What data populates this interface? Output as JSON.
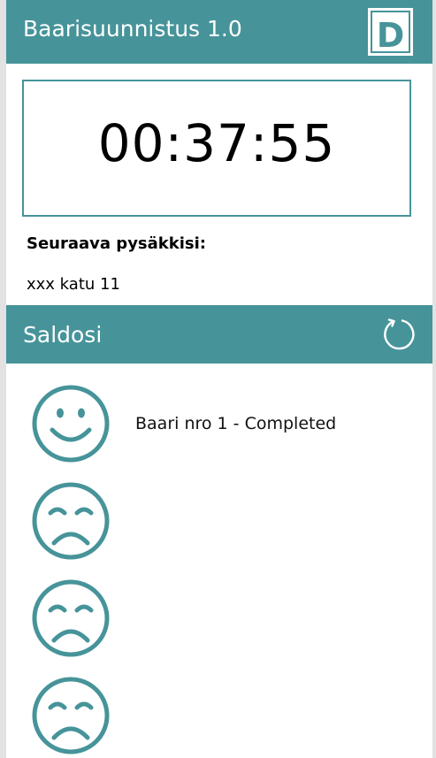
{
  "header": {
    "title": "Baarisuunnistus 1.0",
    "logo_letter": "D"
  },
  "timer": {
    "value": "00:37:55"
  },
  "next_stop": {
    "label": "Seuraava pysäkkisi:",
    "address": "xxx katu 11"
  },
  "balance": {
    "title": "Saldosi",
    "refresh_icon": "refresh-icon"
  },
  "bars": [
    {
      "status": "happy",
      "label": "Baari nro 1 - Completed"
    },
    {
      "status": "sad",
      "label": ""
    },
    {
      "status": "sad",
      "label": ""
    },
    {
      "status": "sad",
      "label": ""
    }
  ],
  "colors": {
    "accent": "#46949a",
    "header_text": "#ffffff",
    "page_background": "#e2e2e2"
  }
}
